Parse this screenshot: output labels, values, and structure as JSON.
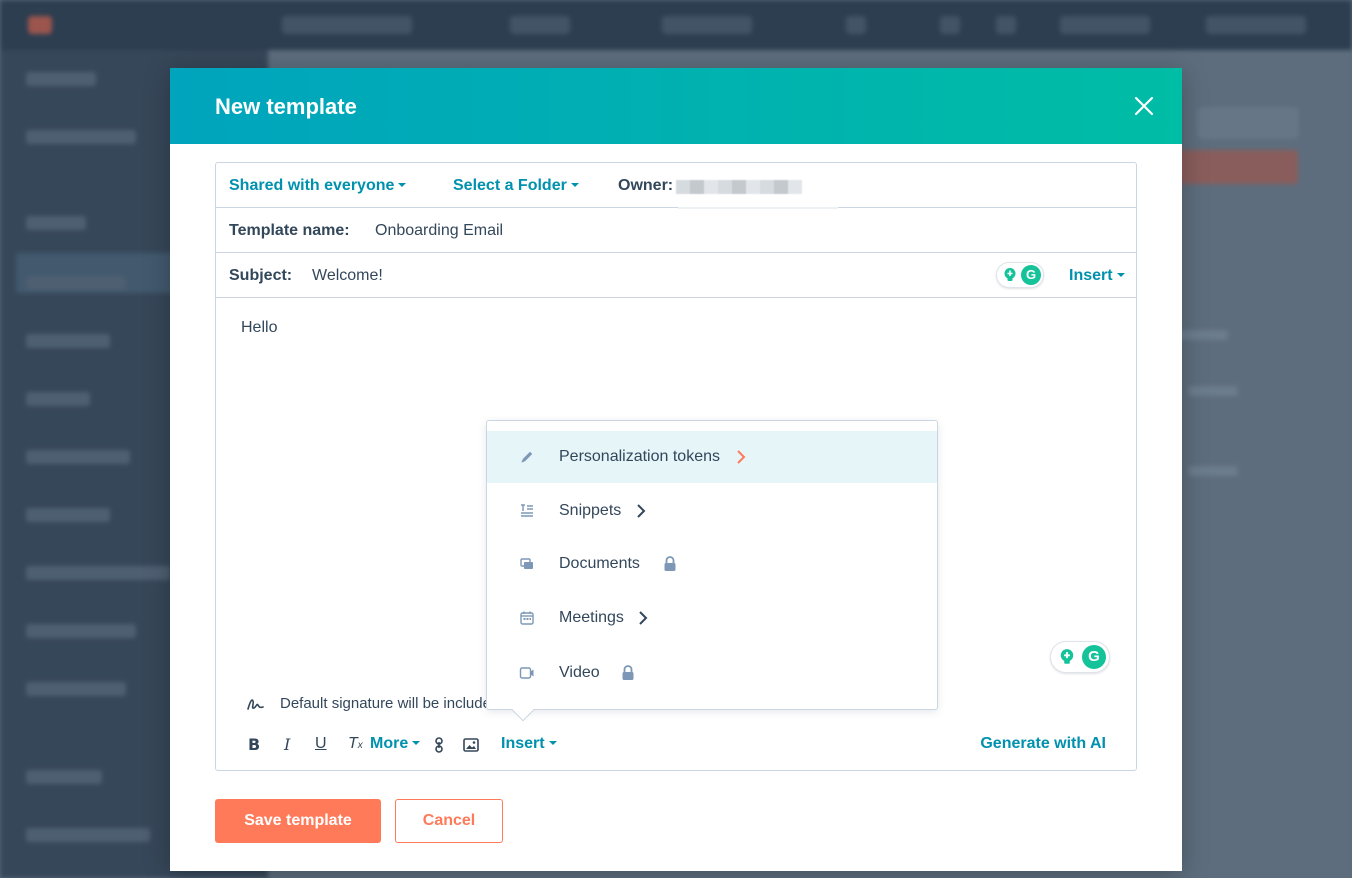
{
  "modal": {
    "title": "New template",
    "sharing": "Shared with everyone",
    "folder": "Select a Folder",
    "owner_label": "Owner:",
    "template_name_label": "Template name:",
    "template_name_value": "Onboarding Email",
    "subject_label": "Subject:",
    "subject_value": "Welcome!",
    "subject_insert": "Insert",
    "body_text": "Hello",
    "signature_text": "Default signature will be included",
    "toolbar": {
      "bold": "B",
      "italic": "I",
      "underline": "U",
      "clear_format": "T",
      "more": "More",
      "insert": "Insert",
      "generate_ai": "Generate with AI"
    },
    "save_button": "Save template",
    "cancel_button": "Cancel"
  },
  "insert_menu": {
    "items": [
      {
        "label": "Personalization tokens",
        "icon": "pencil-icon",
        "has_submenu": true,
        "locked": false,
        "highlighted": true
      },
      {
        "label": "Snippets",
        "icon": "snippets-icon",
        "has_submenu": true,
        "locked": false,
        "highlighted": false
      },
      {
        "label": "Documents",
        "icon": "documents-icon",
        "has_submenu": false,
        "locked": true,
        "highlighted": false
      },
      {
        "label": "Meetings",
        "icon": "calendar-icon",
        "has_submenu": true,
        "locked": false,
        "highlighted": false
      },
      {
        "label": "Video",
        "icon": "video-icon",
        "has_submenu": false,
        "locked": true,
        "highlighted": false
      }
    ]
  },
  "colors": {
    "header_start": "#00a4bd",
    "header_end": "#00bda5",
    "link": "#0091ae",
    "primary": "#ff7a59",
    "highlight_chevron": "#ff7a59"
  }
}
